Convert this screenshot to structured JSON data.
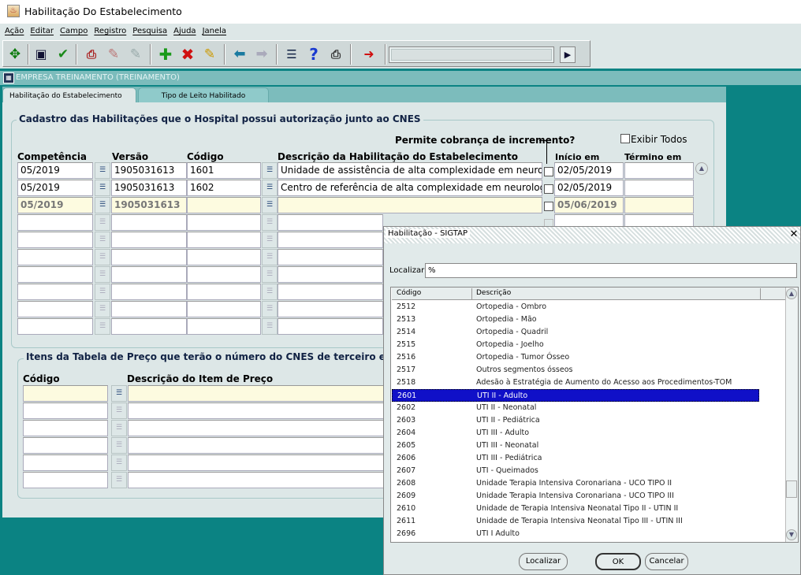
{
  "window": {
    "title": "Habilitação Do Estabelecimento"
  },
  "menu": [
    "Ação",
    "Editar",
    "Campo",
    "Registro",
    "Pesquisa",
    "Ajuda",
    "Janela"
  ],
  "form_header": "EMPRESA TREINAMENTO (TREINAMENTO)",
  "tabs": [
    {
      "label": "Habilitação do Estabelecimento",
      "active": true
    },
    {
      "label": "Tipo de Leito Habilitado",
      "active": false
    }
  ],
  "section1": {
    "title": "Cadastro das Habilitações que o Hospital possui autorização junto ao CNES",
    "permite_label": "Permite cobrança de incremento?",
    "exibir_todos": "Exibir Todos",
    "headers": {
      "competencia": "Competência",
      "versao": "Versão",
      "codigo": "Código",
      "descricao": "Descrição da Habilitação do Estabelecimento",
      "inicio": "Início em",
      "termino": "Término em"
    },
    "rows": [
      {
        "competencia": "05/2019",
        "versao": "1905031613",
        "codigo": "1601",
        "descricao": "Unidade de assistência de alta complexidade em neurologia/n",
        "inicio": "02/05/2019",
        "termino": ""
      },
      {
        "competencia": "05/2019",
        "versao": "1905031613",
        "codigo": "1602",
        "descricao": "Centro de referência de alta complexidade em neurologia/ne",
        "inicio": "02/05/2019",
        "termino": ""
      },
      {
        "competencia": "05/2019",
        "versao": "1905031613",
        "codigo": "",
        "descricao": "",
        "inicio": "05/06/2019",
        "termino": ""
      }
    ]
  },
  "section2": {
    "title": "Itens da Tabela de Preço que terão o número do CNES de terceiro enviad",
    "headers": {
      "codigo": "Código",
      "descricao": "Descrição do Item de Preço"
    }
  },
  "dialog": {
    "title": "Habilitação - SIGTAP",
    "close": "✕",
    "localizar_label": "Localizar",
    "localizar_value": "%",
    "col_codigo": "Código",
    "col_descricao": "Descrição",
    "rows": [
      {
        "codigo": "2512",
        "descricao": "Ortopedia - Ombro"
      },
      {
        "codigo": "2513",
        "descricao": "Ortopedia - Mão"
      },
      {
        "codigo": "2514",
        "descricao": "Ortopedia - Quadril"
      },
      {
        "codigo": "2515",
        "descricao": "Ortopedia - Joelho"
      },
      {
        "codigo": "2516",
        "descricao": "Ortopedia - Tumor Ósseo"
      },
      {
        "codigo": "2517",
        "descricao": "Outros segmentos ósseos"
      },
      {
        "codigo": "2518",
        "descricao": "Adesão à Estratégia de Aumento do Acesso aos Procedimentos-TOM"
      },
      {
        "codigo": "2601",
        "descricao": "UTI II - Adulto",
        "selected": true
      },
      {
        "codigo": "2602",
        "descricao": "UTI II - Neonatal"
      },
      {
        "codigo": "2603",
        "descricao": "UTI II - Pediátrica"
      },
      {
        "codigo": "2604",
        "descricao": "UTI III - Adulto"
      },
      {
        "codigo": "2605",
        "descricao": "UTI III - Neonatal"
      },
      {
        "codigo": "2606",
        "descricao": "UTI III - Pediátrica"
      },
      {
        "codigo": "2607",
        "descricao": "UTI - Queimados"
      },
      {
        "codigo": "2608",
        "descricao": "Unidade Terapia Intensiva Coronariana - UCO TIPO II"
      },
      {
        "codigo": "2609",
        "descricao": "Unidade Terapia Intensiva Coronariana - UCO TIPO III"
      },
      {
        "codigo": "2610",
        "descricao": "Unidade de Terapia Intensiva Neonatal Tipo II - UTIN II"
      },
      {
        "codigo": "2611",
        "descricao": "Unidade de Terapia Intensiva Neonatal Tipo III - UTIN III"
      },
      {
        "codigo": "2696",
        "descricao": "UTI I Adulto"
      }
    ],
    "btn_localizar": "Localizar",
    "btn_ok": "OK",
    "btn_cancelar": "Cancelar"
  }
}
